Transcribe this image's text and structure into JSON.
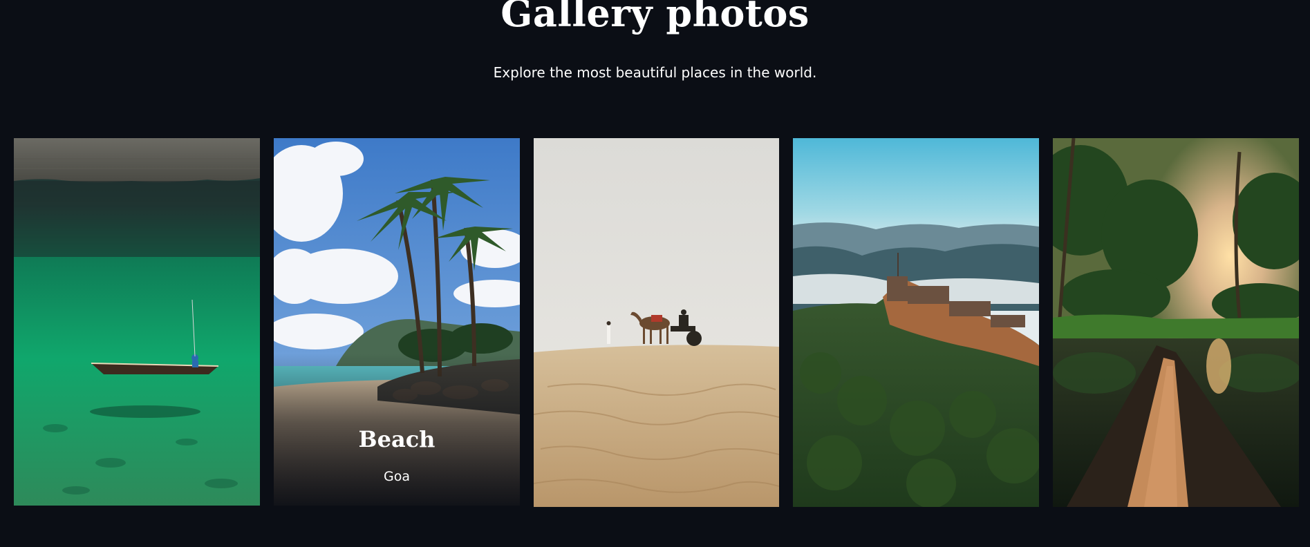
{
  "header": {
    "title": "Gallery photos",
    "subtitle": "Explore the most beautiful places in the world."
  },
  "gallery": {
    "cards": [
      {
        "scene": "clear green lake with fishing boat"
      },
      {
        "scene": "tropical beach with palm trees",
        "title": "Beach",
        "subtitle": "Goa"
      },
      {
        "scene": "desert dunes with camel cart"
      },
      {
        "scene": "hilltop fort above misty valleys"
      },
      {
        "scene": "backwater canal with canoe at sunset"
      }
    ]
  },
  "colors": {
    "background": "#0b0e15",
    "text": "#ffffff"
  }
}
